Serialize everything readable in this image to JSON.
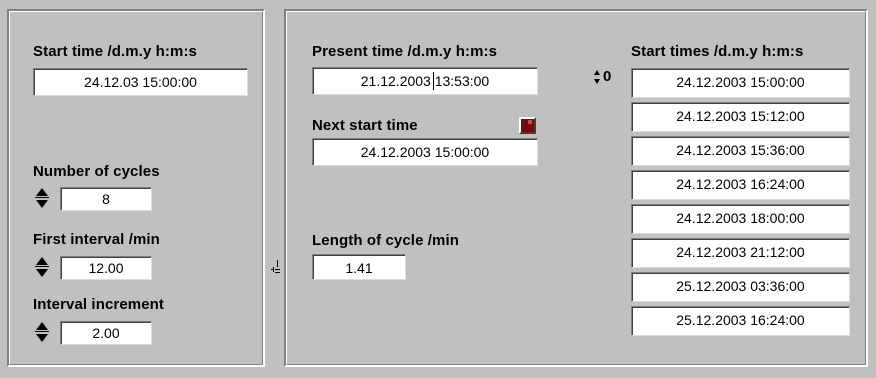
{
  "left": {
    "start_time_label": "Start time /d.m.y h:m:s",
    "start_time_value": "24.12.03 15:00:00",
    "cycles_label": "Number of cycles",
    "cycles_value": "8",
    "first_interval_label": "First interval /min",
    "first_interval_value": "12.00",
    "increment_label": "Interval increment",
    "increment_value": "2.00"
  },
  "right": {
    "present_time_label": "Present time /d.m.y h:m:s",
    "present_time_value": "21.12.2003 13:53:00",
    "next_start_label": "Next start time",
    "next_start_value": "24.12.2003 15:00:00",
    "cycle_length_label": "Length of cycle /min",
    "cycle_length_value": "1.41",
    "start_times_label": "Start times /d.m.y h:m:s",
    "start_times_index": "0",
    "start_times": [
      "24.12.2003 15:00:00",
      "24.12.2003 15:12:00",
      "24.12.2003 15:36:00",
      "24.12.2003 16:24:00",
      "24.12.2003 18:00:00",
      "24.12.2003 21:12:00",
      "25.12.2003 03:36:00",
      "25.12.2003 16:24:00"
    ]
  },
  "colors": {
    "background": "#c0c0c0",
    "led": "#7a0a0a"
  }
}
